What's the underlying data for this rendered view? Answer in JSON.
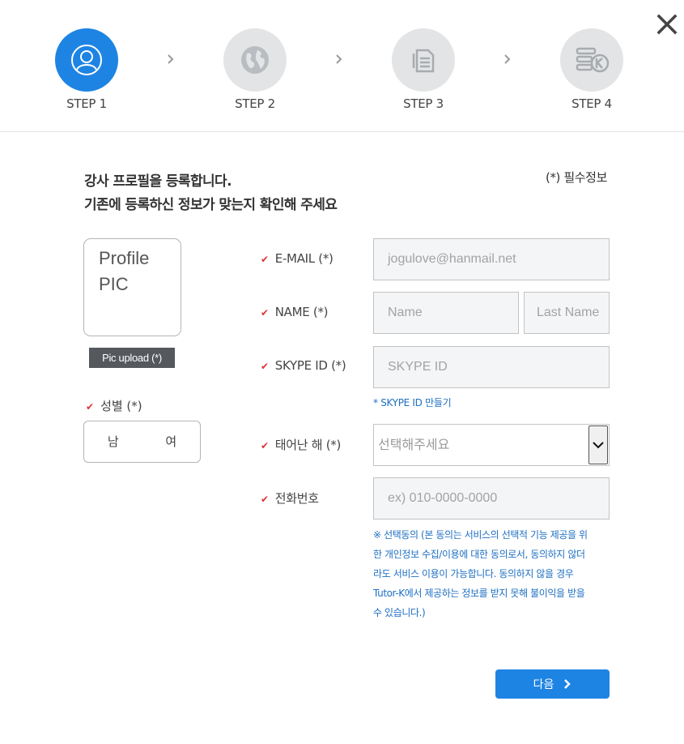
{
  "steps": [
    {
      "label": "STEP 1",
      "icon": "user-icon",
      "active": true
    },
    {
      "label": "STEP 2",
      "icon": "globe-icon",
      "active": false
    },
    {
      "label": "STEP 3",
      "icon": "document-icon",
      "active": false
    },
    {
      "label": "STEP 4",
      "icon": "k-list-icon",
      "active": false
    }
  ],
  "intro": {
    "line1": "강사 프로필을 등록합니다.",
    "line2": "기존에 등록하신 정보가 맞는지 확인해 주세요"
  },
  "required_note": "(*) 필수정보",
  "profile": {
    "pic_line1": "Profile",
    "pic_line2": "PIC",
    "upload_label": "Pic upload (*)"
  },
  "gender": {
    "label": "성별 (*)",
    "male": "남",
    "female": "여"
  },
  "form": {
    "email_label": "E-MAIL (*)",
    "email_value": "jogulove@hanmail.net",
    "name_label": "NAME (*)",
    "name_placeholder": "Name",
    "lastname_placeholder": "Last Name",
    "skype_label": "SKYPE ID (*)",
    "skype_placeholder": "SKYPE ID",
    "skype_link": "* SKYPE ID 만들기",
    "birth_label": "태어난 해 (*)",
    "birth_selected": "선택해주세요",
    "phone_label": "전화번호",
    "phone_placeholder": "ex) 010-0000-0000",
    "consent_l1": "※ 선택동의 (본 동의는 서비스의 선택적 기능 제공을 위",
    "consent_l2": "한 개인정보 수집/이용에 대한 동의로서, 동의하지 않더",
    "consent_l3": "라도 서비스 이용이 가능합니다. 동의하지 않을 경우",
    "consent_l4": "Tutor-K에서 제공하는 정보를 받지 못해 불이익을 받을",
    "consent_l5": "수 있습니다.)"
  },
  "next_button": "다음",
  "colors": {
    "accent": "#1e84e3",
    "check": "#e0313a",
    "link": "#1e6fc2"
  }
}
